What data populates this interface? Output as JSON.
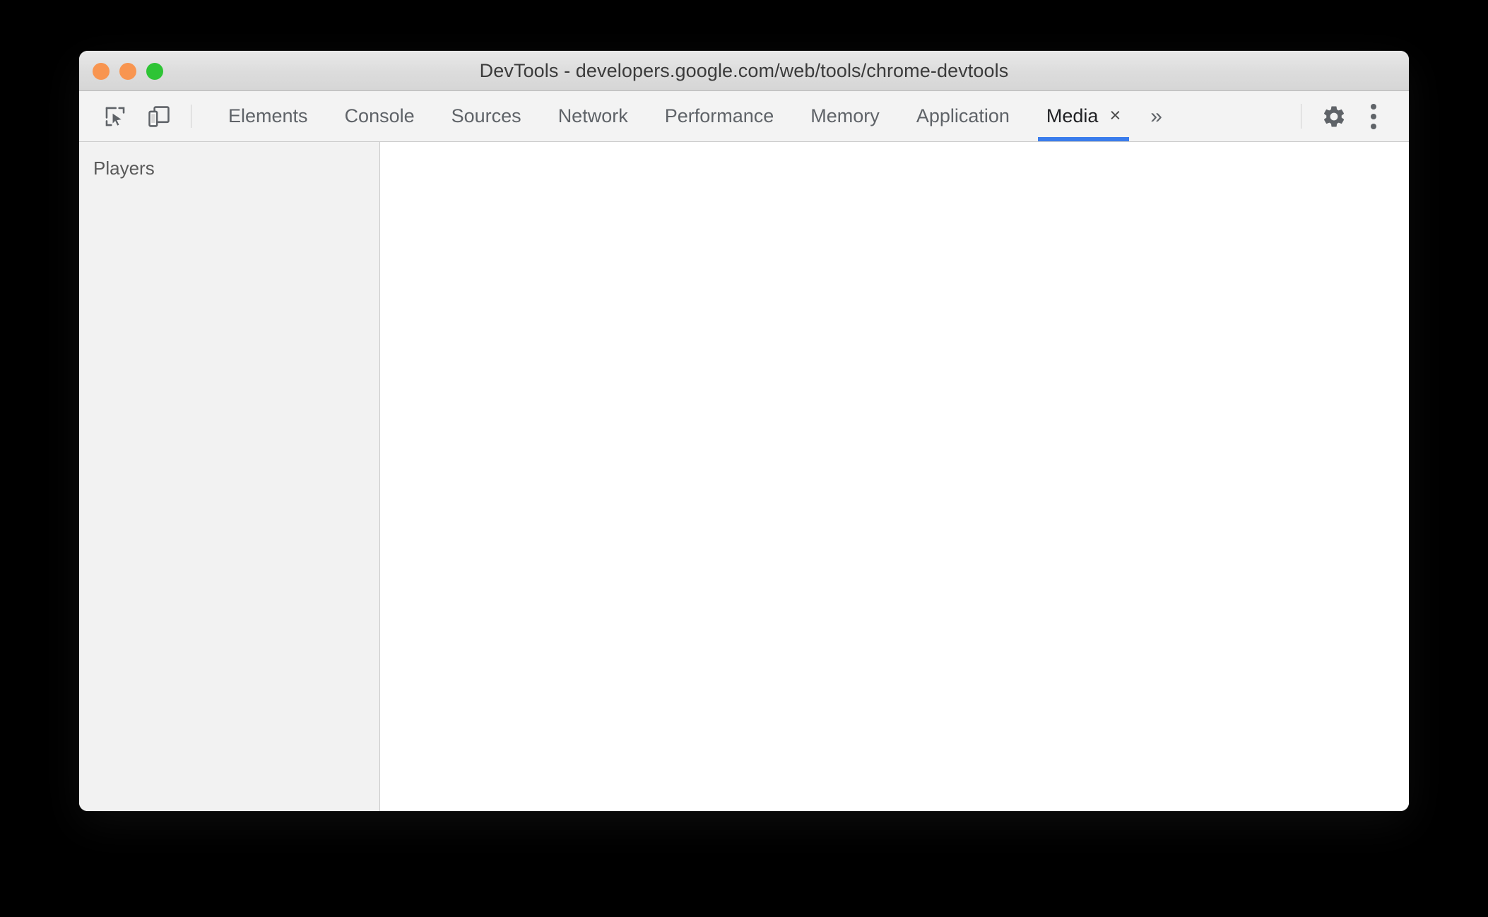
{
  "window": {
    "title": "DevTools - developers.google.com/web/tools/chrome-devtools",
    "traffic_lights": [
      {
        "name": "close-button",
        "color": "#f89550"
      },
      {
        "name": "minimize-button",
        "color": "#f89550"
      },
      {
        "name": "maximize-button",
        "color": "#2ec435"
      }
    ]
  },
  "toolbar": {
    "inspect_icon": "inspect-element-icon",
    "device_toolbar_icon": "device-toolbar-icon",
    "tabs": [
      {
        "label": "Elements",
        "active": false,
        "closable": false
      },
      {
        "label": "Console",
        "active": false,
        "closable": false
      },
      {
        "label": "Sources",
        "active": false,
        "closable": false
      },
      {
        "label": "Network",
        "active": false,
        "closable": false
      },
      {
        "label": "Performance",
        "active": false,
        "closable": false
      },
      {
        "label": "Memory",
        "active": false,
        "closable": false
      },
      {
        "label": "Application",
        "active": false,
        "closable": false
      },
      {
        "label": "Media",
        "active": true,
        "closable": true
      }
    ],
    "tab_close_glyph": "×",
    "more_tabs_glyph": "»",
    "settings_icon": "gear-icon",
    "more_options_icon": "three-dots-vertical-icon",
    "accent_color": "#3a7cec"
  },
  "media_panel": {
    "sidebar": {
      "header": "Players",
      "items": []
    },
    "main": {
      "empty_message": ""
    }
  }
}
